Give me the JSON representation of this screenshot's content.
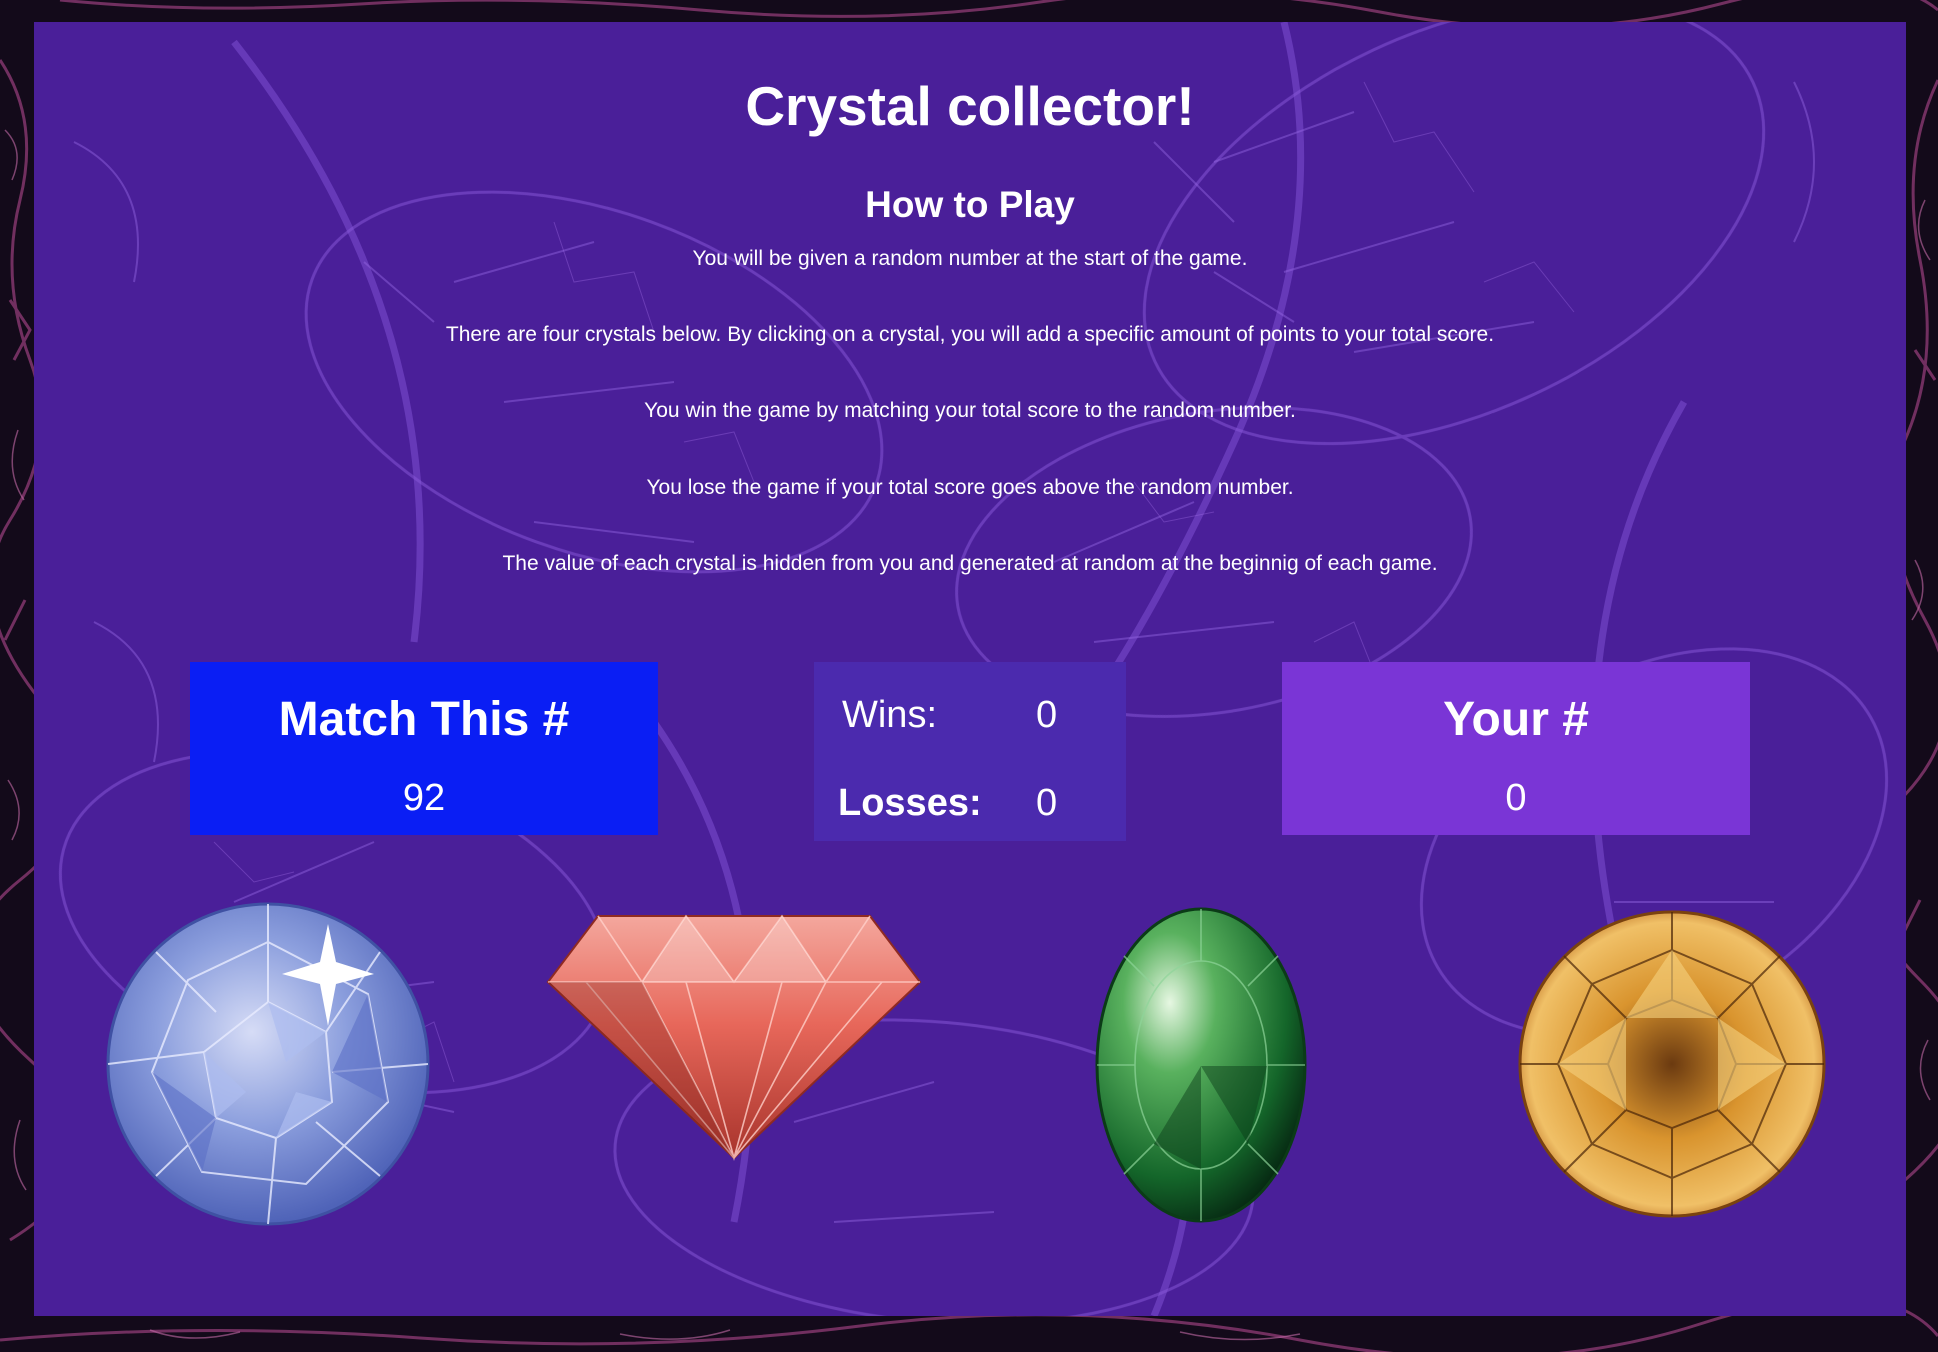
{
  "game": {
    "title": "Crystal collector!",
    "how_to_heading": "How to Play",
    "rules": [
      "You will be given a random number at the start of the game.",
      "There are four crystals below. By clicking on a crystal, you will add a specific amount of points to your total score.",
      "You win the game by matching your total score to the random number.",
      "You lose the game if your total score goes above the random number.",
      "The value of each crystal is hidden from you and generated at random at the beginnig of each game."
    ]
  },
  "target": {
    "label": "Match This #",
    "value": "92"
  },
  "tally": {
    "wins_label": "Wins:",
    "wins": "0",
    "losses_label": "Losses:",
    "losses": "0"
  },
  "score": {
    "label": "Your #",
    "value": "0"
  },
  "crystals": [
    {
      "name": "blue-round-crystal",
      "color": "#7f94d6"
    },
    {
      "name": "red-diamond-crystal",
      "color": "#e7675a"
    },
    {
      "name": "green-oval-crystal",
      "color": "#1f8f3a"
    },
    {
      "name": "orange-round-crystal",
      "color": "#d9942e"
    }
  ],
  "colors": {
    "panel": "#4a1f99",
    "target_box": "#0a1ef4",
    "tally_box": "#4b2aae",
    "score_box": "#7a35d6"
  }
}
